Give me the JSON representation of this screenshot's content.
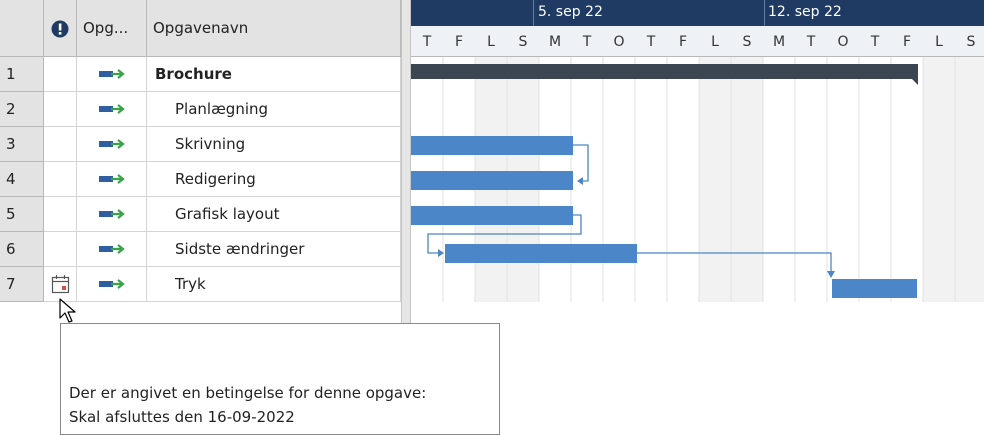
{
  "header": {
    "indicator_icon": "exclamation-info-icon",
    "mode_col": "Opg...",
    "name_col": "Opgavenavn"
  },
  "rows": [
    {
      "id": "1",
      "name": "Brochure",
      "summary": true,
      "indicator": ""
    },
    {
      "id": "2",
      "name": "Planlægning",
      "summary": false,
      "indicator": ""
    },
    {
      "id": "3",
      "name": "Skrivning",
      "summary": false,
      "indicator": ""
    },
    {
      "id": "4",
      "name": "Redigering",
      "summary": false,
      "indicator": ""
    },
    {
      "id": "5",
      "name": "Grafisk layout",
      "summary": false,
      "indicator": ""
    },
    {
      "id": "6",
      "name": "Sidste ændringer",
      "summary": false,
      "indicator": ""
    },
    {
      "id": "7",
      "name": "Tryk",
      "summary": false,
      "indicator": "calendar-constraint-icon"
    }
  ],
  "timeline": {
    "weeks": [
      "5. sep 22",
      "12. sep 22"
    ],
    "days": [
      "T",
      "F",
      "L",
      "S",
      "M",
      "T",
      "O",
      "T",
      "F",
      "L",
      "S",
      "M",
      "T",
      "O",
      "T",
      "F",
      "L",
      "S"
    ]
  },
  "tooltip": {
    "line1": "Der er angivet en betingelse for denne opgave:",
    "line2": "Skal afsluttes den 16-09-2022"
  },
  "colors": {
    "bar": "#4a86c8",
    "summary_bar": "#3b4652",
    "timescale_top": "#1f3b63"
  }
}
